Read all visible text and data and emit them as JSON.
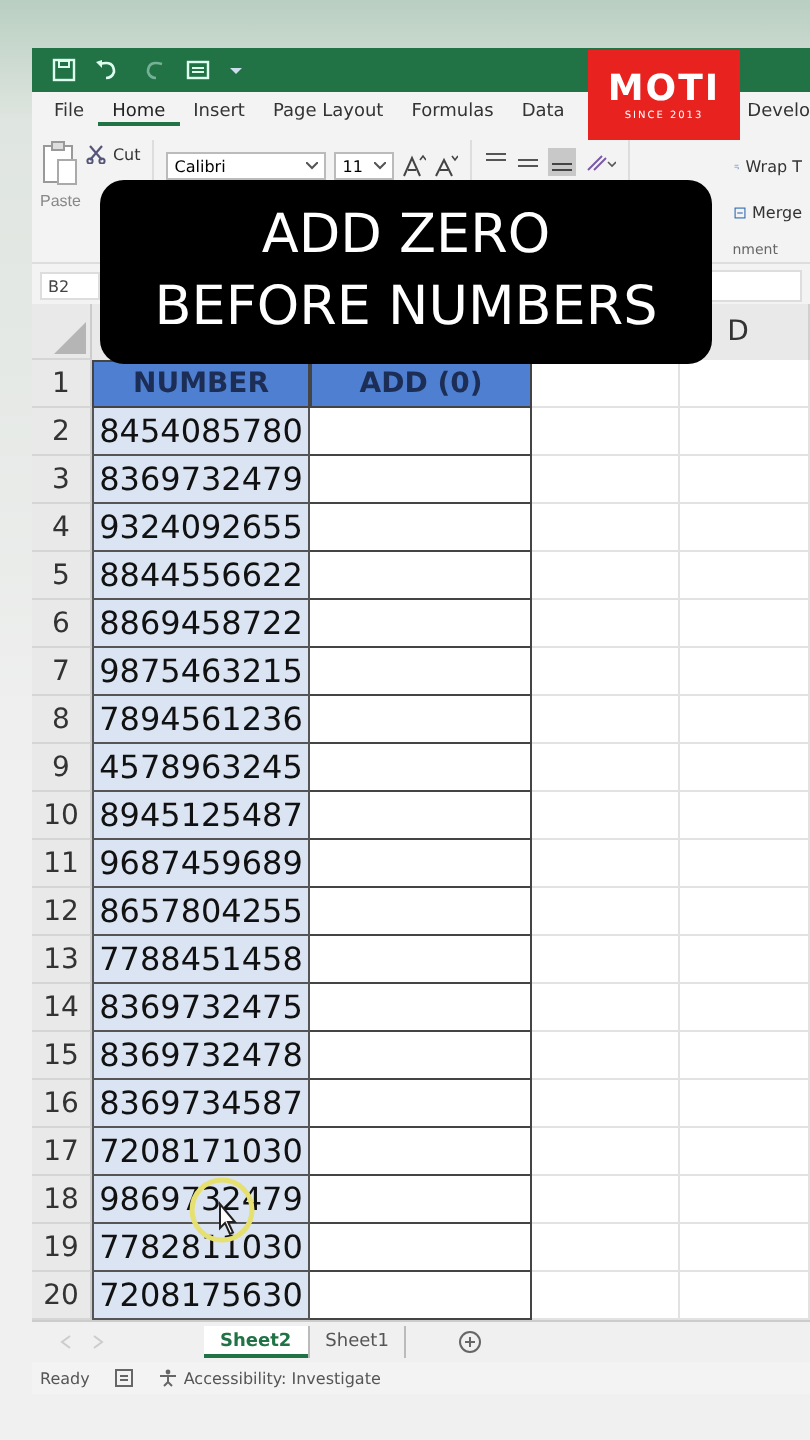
{
  "logo": {
    "name": "MOTI",
    "tagline": "SINCE 2013"
  },
  "ribbon_tabs": [
    {
      "label": "File",
      "selected": false
    },
    {
      "label": "Home",
      "selected": true
    },
    {
      "label": "Insert",
      "selected": false
    },
    {
      "label": "Page Layout",
      "selected": false
    },
    {
      "label": "Formulas",
      "selected": false
    },
    {
      "label": "Data",
      "selected": false
    },
    {
      "label": "Develo",
      "selected": false
    }
  ],
  "ribbon": {
    "paste": "Paste",
    "cut": "Cut",
    "font_family": "Calibri",
    "font_size": "11",
    "wrap_text": "Wrap T",
    "merge": "Merge",
    "group_label": "nment"
  },
  "caption": {
    "lines": [
      "ADD ZERO",
      "BEFORE NUMBERS"
    ]
  },
  "name_box": "B2",
  "column_headers": [
    "D"
  ],
  "table": {
    "header": {
      "row": "1",
      "number": "NUMBER",
      "add": "ADD (0)"
    },
    "rows": [
      {
        "row": "2",
        "number": "8454085780"
      },
      {
        "row": "3",
        "number": "8369732479"
      },
      {
        "row": "4",
        "number": "9324092655"
      },
      {
        "row": "5",
        "number": "8844556622"
      },
      {
        "row": "6",
        "number": "8869458722"
      },
      {
        "row": "7",
        "number": "9875463215"
      },
      {
        "row": "8",
        "number": "7894561236"
      },
      {
        "row": "9",
        "number": "4578963245"
      },
      {
        "row": "10",
        "number": "8945125487"
      },
      {
        "row": "11",
        "number": "9687459689"
      },
      {
        "row": "12",
        "number": "8657804255"
      },
      {
        "row": "13",
        "number": "7788451458"
      },
      {
        "row": "14",
        "number": "8369732475"
      },
      {
        "row": "15",
        "number": "8369732478"
      },
      {
        "row": "16",
        "number": "8369734587"
      },
      {
        "row": "17",
        "number": "7208171030"
      },
      {
        "row": "18",
        "number": "9869732479"
      },
      {
        "row": "19",
        "number": "7782811030"
      },
      {
        "row": "20",
        "number": "7208175630"
      }
    ]
  },
  "sheet_tabs": [
    {
      "label": "Sheet2",
      "selected": true
    },
    {
      "label": "Sheet1",
      "selected": false
    }
  ],
  "status_bar": {
    "state": "Ready",
    "accessibility": "Accessibility: Investigate"
  }
}
